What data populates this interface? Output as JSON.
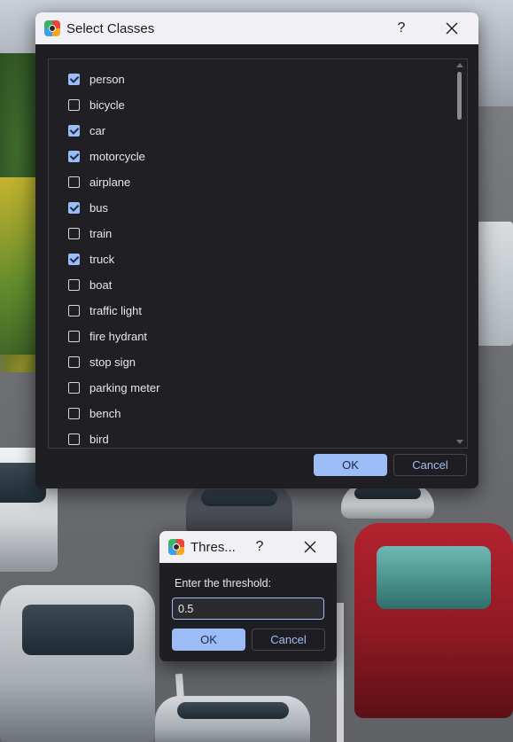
{
  "classes_dialog": {
    "title": "Select Classes",
    "help_glyph": "?",
    "items": [
      {
        "label": "person",
        "checked": true
      },
      {
        "label": "bicycle",
        "checked": false
      },
      {
        "label": "car",
        "checked": true
      },
      {
        "label": "motorcycle",
        "checked": true
      },
      {
        "label": "airplane",
        "checked": false
      },
      {
        "label": "bus",
        "checked": true
      },
      {
        "label": "train",
        "checked": false
      },
      {
        "label": "truck",
        "checked": true
      },
      {
        "label": "boat",
        "checked": false
      },
      {
        "label": "traffic light",
        "checked": false
      },
      {
        "label": "fire hydrant",
        "checked": false
      },
      {
        "label": "stop sign",
        "checked": false
      },
      {
        "label": "parking meter",
        "checked": false
      },
      {
        "label": "bench",
        "checked": false
      },
      {
        "label": "bird",
        "checked": false
      }
    ],
    "ok_label": "OK",
    "cancel_label": "Cancel"
  },
  "threshold_dialog": {
    "title": "Thres...",
    "help_glyph": "?",
    "prompt": "Enter the threshold:",
    "input_value": "0.5",
    "ok_label": "OK",
    "cancel_label": "Cancel"
  },
  "colors": {
    "accent": "#9bbcf6",
    "dialog_bg": "#1f1f23",
    "titlebar_bg": "#f1f1f5"
  },
  "icons": {
    "app": "app-logo-icon",
    "help": "question-mark-icon",
    "close": "close-icon"
  }
}
